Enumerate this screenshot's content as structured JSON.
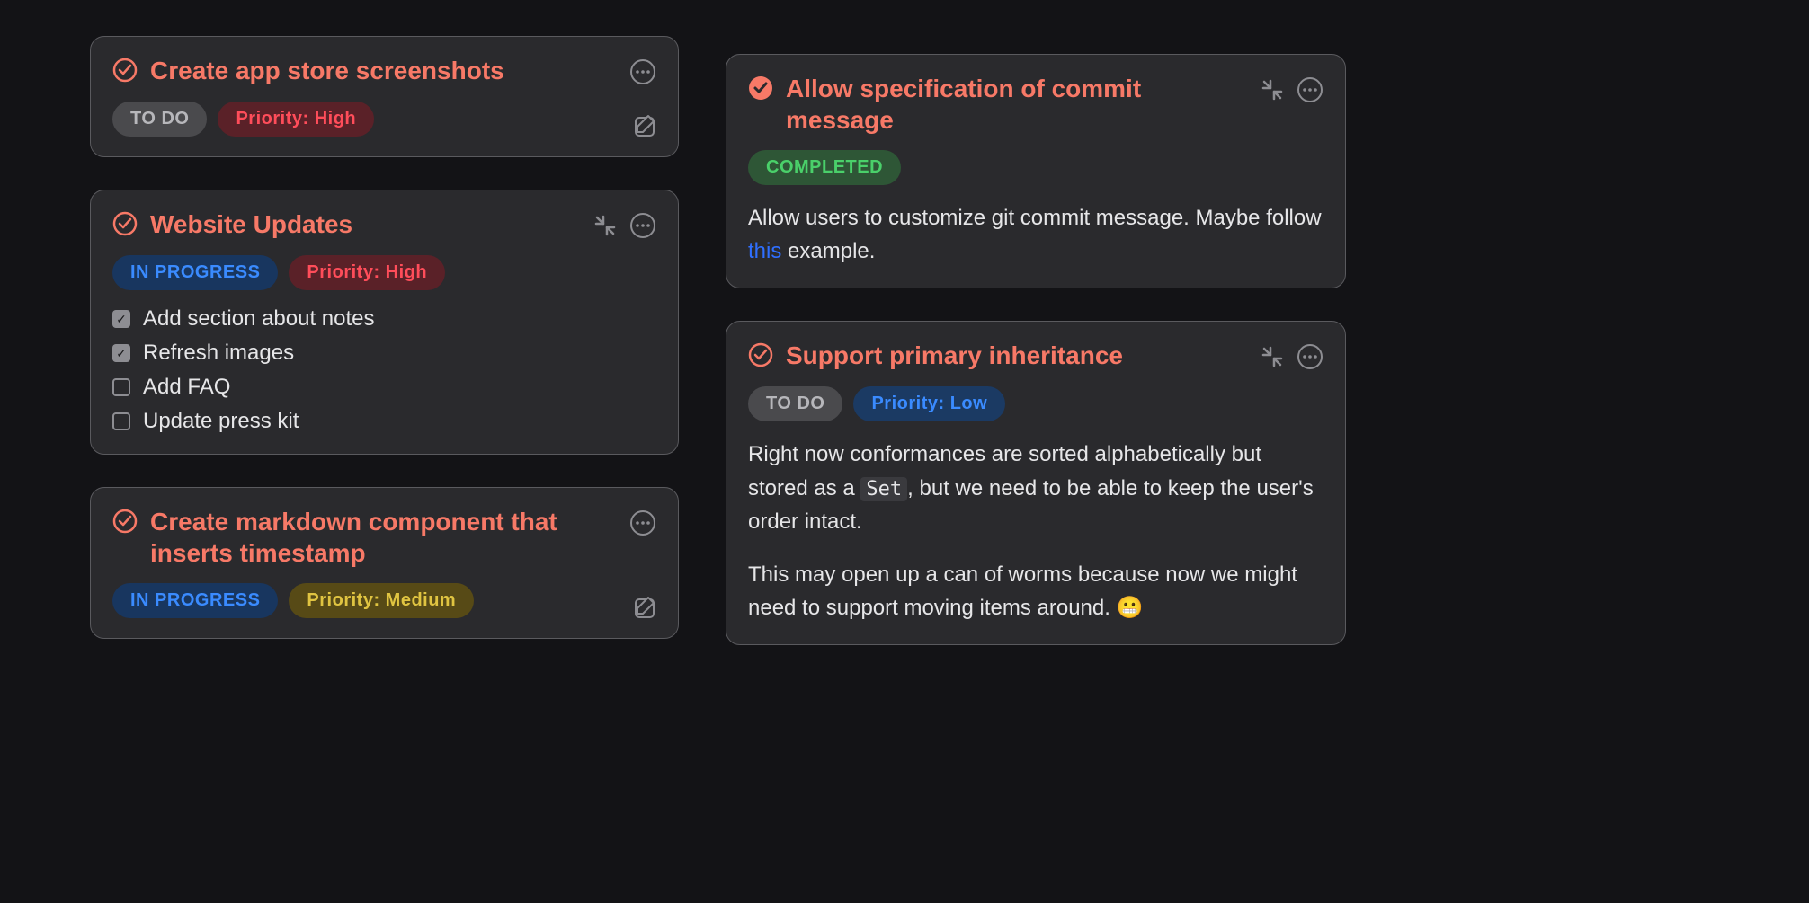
{
  "left": [
    {
      "title": "Create app store screenshots",
      "status": {
        "label": "TO DO",
        "style": "todo"
      },
      "priority": {
        "label": "Priority: High",
        "style": "p-high"
      },
      "completed": false,
      "expanded": false,
      "showEdit": true
    },
    {
      "title": "Website Updates",
      "status": {
        "label": "IN PROGRESS",
        "style": "progress"
      },
      "priority": {
        "label": "Priority: High",
        "style": "p-high"
      },
      "completed": false,
      "expanded": true,
      "checklist": [
        {
          "done": true,
          "text": "Add section about notes"
        },
        {
          "done": true,
          "text": "Refresh images"
        },
        {
          "done": false,
          "text": "Add FAQ"
        },
        {
          "done": false,
          "text": "Update press kit"
        }
      ]
    },
    {
      "title": "Create markdown component that inserts timestamp",
      "status": {
        "label": "IN PROGRESS",
        "style": "progress"
      },
      "priority": {
        "label": "Priority: Medium",
        "style": "p-med"
      },
      "completed": false,
      "expanded": false,
      "showEdit": true
    }
  ],
  "right": [
    {
      "title": "Allow specification of commit message",
      "status": {
        "label": "COMPLETED",
        "style": "done"
      },
      "completed": true,
      "expanded": true,
      "body": {
        "pre": "Allow users to customize git commit message. Maybe follow ",
        "link": "this",
        "post": " example."
      }
    },
    {
      "title": "Support primary inheritance",
      "status": {
        "label": "TO DO",
        "style": "todo"
      },
      "priority": {
        "label": "Priority: Low",
        "style": "p-low"
      },
      "completed": false,
      "expanded": true,
      "body2": {
        "p1a": "Right now conformances are sorted alphabetically but stored as a ",
        "code": "Set",
        "p1b": ", but we need to be able to keep the user's order intact.",
        "p2": "This may open up a can of worms because now we might need to support moving items around. 😬"
      }
    }
  ]
}
